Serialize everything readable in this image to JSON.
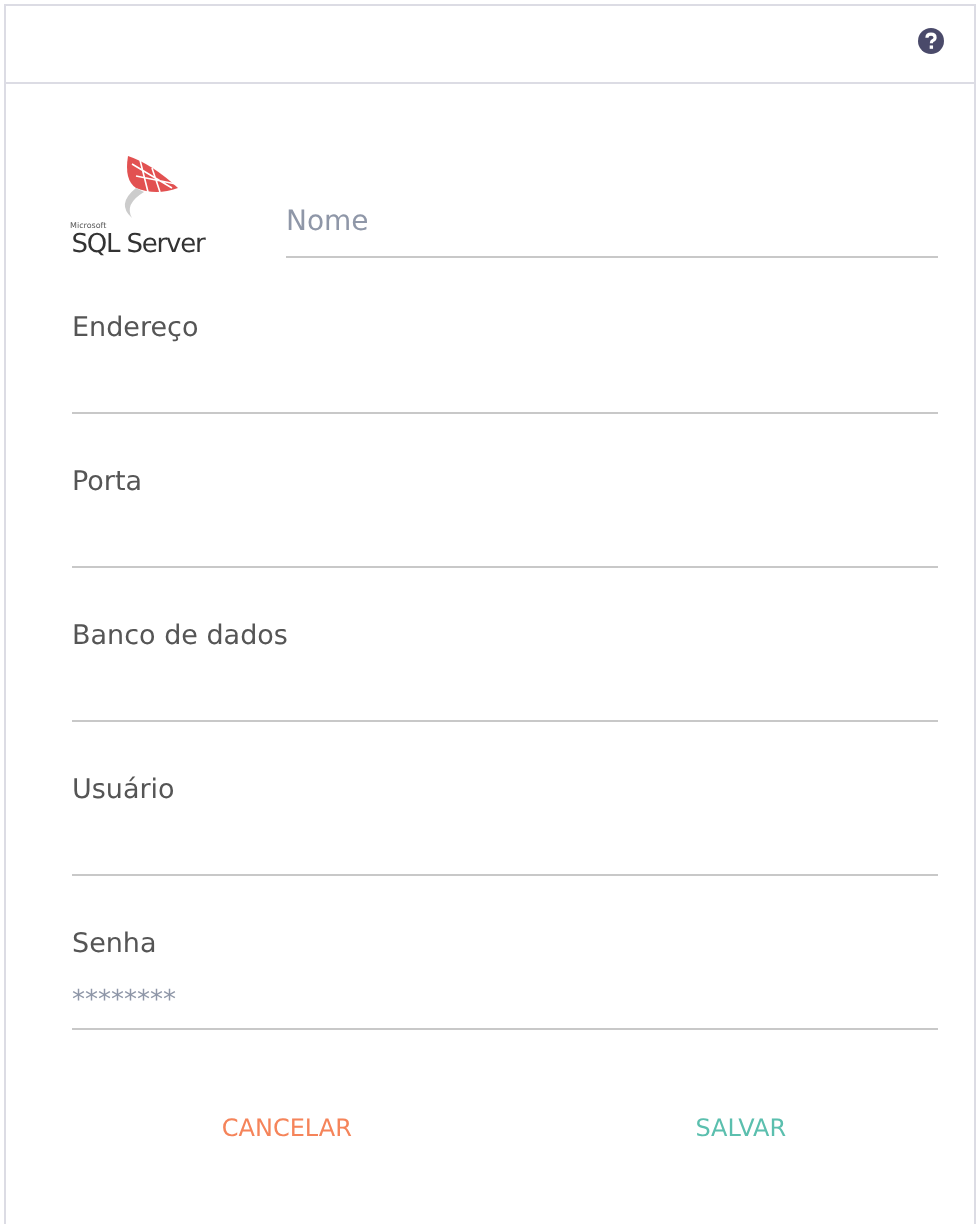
{
  "logo": {
    "small_text": "Microsoft",
    "text": "SQL Server"
  },
  "name_field": {
    "placeholder": "Nome"
  },
  "fields": [
    {
      "label": "Endereço"
    },
    {
      "label": "Porta"
    },
    {
      "label": "Banco de dados"
    },
    {
      "label": "Usuário"
    },
    {
      "label": "Senha",
      "placeholder": "********"
    }
  ],
  "buttons": [
    {
      "label": "CANCELAR",
      "kind": "cancel"
    },
    {
      "label": "SALVAR",
      "kind": "save"
    }
  ]
}
